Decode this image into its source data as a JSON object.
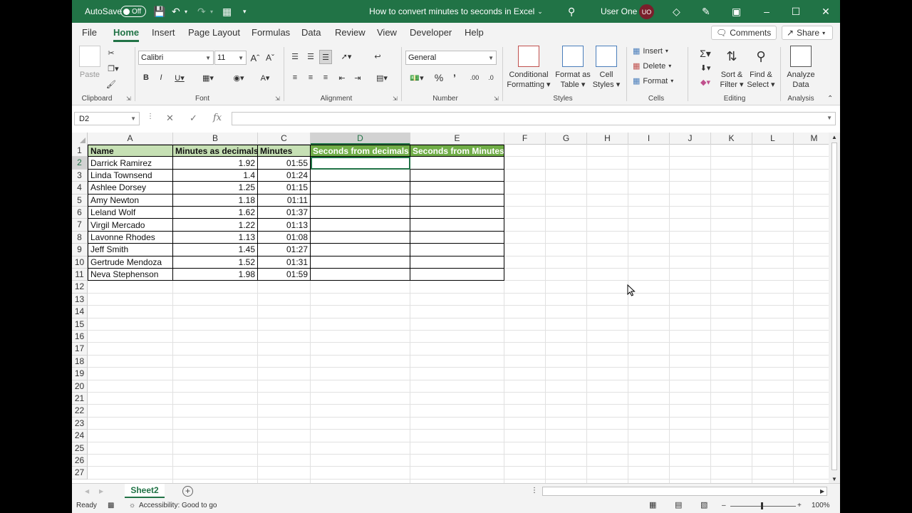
{
  "titlebar": {
    "autosave": "AutoSave",
    "toggle": "Off",
    "doc_title": "How to convert minutes to seconds in Excel",
    "user": "User One",
    "initials": "UO"
  },
  "tabs": [
    "File",
    "Home",
    "Insert",
    "Page Layout",
    "Formulas",
    "Data",
    "Review",
    "View",
    "Developer",
    "Help"
  ],
  "active_tab": "Home",
  "comments_label": "Comments",
  "share_label": "Share",
  "ribbon": {
    "paste": "Paste",
    "clipboard": "Clipboard",
    "font_name": "Calibri",
    "font_size": "11",
    "font_group": "Font",
    "alignment_group": "Alignment",
    "number_format": "General",
    "number_group": "Number",
    "conditional": [
      "Conditional",
      "Formatting"
    ],
    "format_table": [
      "Format as",
      "Table"
    ],
    "cell_styles": [
      "Cell",
      "Styles"
    ],
    "styles_group": "Styles",
    "insert": "Insert",
    "delete": "Delete",
    "format": "Format",
    "cells_group": "Cells",
    "sort": [
      "Sort &",
      "Filter"
    ],
    "find": [
      "Find &",
      "Select"
    ],
    "editing_group": "Editing",
    "analyze": [
      "Analyze",
      "Data"
    ],
    "analysis_group": "Analysis"
  },
  "formula_bar": {
    "name_box": "D2",
    "fx": "fx",
    "value": ""
  },
  "columns": [
    "A",
    "B",
    "C",
    "D",
    "E",
    "F",
    "G",
    "H",
    "I",
    "J",
    "K",
    "L",
    "M"
  ],
  "selected_column": "D",
  "selected_row": 2,
  "rows": [
    "1",
    "2",
    "3",
    "4",
    "5",
    "6",
    "7",
    "8",
    "9",
    "10",
    "11",
    "12",
    "13",
    "14",
    "15",
    "16",
    "17",
    "18",
    "19",
    "20",
    "21",
    "22",
    "23",
    "24",
    "25",
    "26",
    "27"
  ],
  "table": {
    "headers": [
      "Name",
      "Minutes as decimals",
      "Minutes",
      "Seconds from decimals",
      "Seconds from Minutes"
    ],
    "rows": [
      [
        "Darrick Ramirez",
        "1.92",
        "01:55",
        "",
        ""
      ],
      [
        "Linda Townsend",
        "1.4",
        "01:24",
        "",
        ""
      ],
      [
        "Ashlee Dorsey",
        "1.25",
        "01:15",
        "",
        ""
      ],
      [
        "Amy Newton",
        "1.18",
        "01:11",
        "",
        ""
      ],
      [
        "Leland Wolf",
        "1.62",
        "01:37",
        "",
        ""
      ],
      [
        "Virgil Mercado",
        "1.22",
        "01:13",
        "",
        ""
      ],
      [
        "Lavonne Rhodes",
        "1.13",
        "01:08",
        "",
        ""
      ],
      [
        "Jeff Smith",
        "1.45",
        "01:27",
        "",
        ""
      ],
      [
        "Gertrude Mendoza",
        "1.52",
        "01:31",
        "",
        ""
      ],
      [
        "Neva Stephenson",
        "1.98",
        "01:59",
        "",
        ""
      ]
    ]
  },
  "sheet_tab": "Sheet2",
  "status": {
    "ready": "Ready",
    "accessibility": "Accessibility: Good to go",
    "zoom": "100%"
  }
}
